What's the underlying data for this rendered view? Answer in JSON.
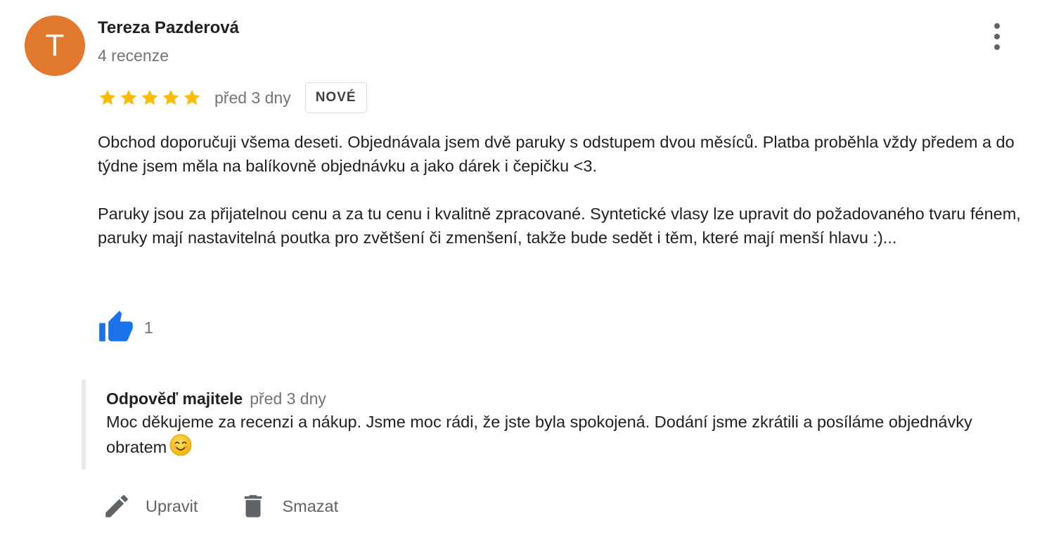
{
  "review": {
    "avatar_letter": "T",
    "avatar_color": "#e0792e",
    "author_name": "Tereza Pazderová",
    "review_count": "4 recenze",
    "rating": 5,
    "rating_max": 5,
    "date": "před 3 dny",
    "badge": "NOVÉ",
    "paragraphs": [
      "Obchod doporučuji všema deseti. Objednávala jsem dvě paruky s odstupem dvou měsíců. Platba proběhla vždy předem a do týdne jsem měla na balíkovně objednávku a jako dárek i čepičku <3.",
      "Paruky jsou za přijatelnou cenu a za tu cenu i kvalitně zpracované. Syntetické vlasy lze upravit do požadovaného tvaru fénem, paruky mají nastavitelná poutka pro zvětšení či zmenšení, takže bude sedět i těm, které mají menší hlavu :)..."
    ],
    "like_count": "1",
    "like_icon": "thumbs-up-icon",
    "more_icon": "more-vertical-icon"
  },
  "owner_reply": {
    "title": "Odpověď majitele",
    "date": "před 3 dny",
    "text": "Moc děkujeme za recenzi a nákup. Jsme moc rádi, že jste byla spokojená. Dodání jsme zkrátili a posíláme objednávky obratem",
    "emoji": "smiling-face-emoji"
  },
  "actions": {
    "edit_label": "Upravit",
    "edit_icon": "pencil-icon",
    "delete_label": "Smazat",
    "delete_icon": "trash-icon"
  },
  "colors": {
    "star": "#fbbc04",
    "like": "#1a73e8",
    "muted_text": "#70757a",
    "action_gray": "#5f6368",
    "reply_border": "#e8eaed"
  }
}
